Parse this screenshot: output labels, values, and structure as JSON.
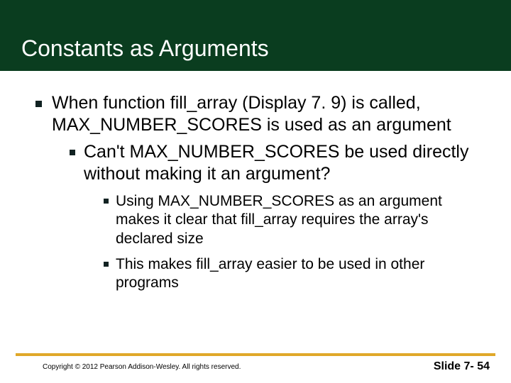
{
  "title": "Constants as Arguments",
  "bullets": {
    "l1": "When function fill_array (Display 7. 9) is called, MAX_NUMBER_SCORES is used as an argument",
    "l2": "Can't MAX_NUMBER_SCORES be used directly without making it an argument?",
    "l3a": "Using MAX_NUMBER_SCORES as an argument makes it clear that fill_array requires the array's declared size",
    "l3b": "This makes fill_array easier to be used in other programs"
  },
  "footer": {
    "copyright": "Copyright © 2012 Pearson Addison-Wesley. All rights reserved.",
    "slide": "Slide 7- 54"
  },
  "colors": {
    "titleBand": "#0a3d1f",
    "accent": "#e0a829"
  }
}
